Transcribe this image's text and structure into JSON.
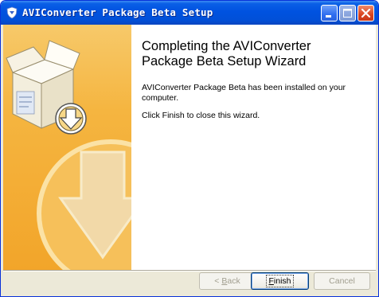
{
  "window": {
    "title": "AVIConverter Package Beta Setup",
    "title_color": "#ffffff"
  },
  "controls": {
    "minimize_icon": "minimize-icon",
    "maximize_icon": "maximize-icon",
    "close_icon": "close-icon"
  },
  "wizard": {
    "heading": "Completing the AVIConverter Package Beta Setup Wizard",
    "message": "AVIConverter Package Beta has been installed on your computer.",
    "instruction": "Click Finish to close this wizard."
  },
  "buttons": {
    "back": {
      "prefix": "< ",
      "accel": "B",
      "rest": "ack",
      "enabled": false
    },
    "finish": {
      "accel": "F",
      "rest": "inish",
      "enabled": true,
      "default": true
    },
    "cancel": {
      "label": "Cancel",
      "enabled": false
    }
  },
  "colors": {
    "side_panel": "#f5b540",
    "titlebar": "#0052e0",
    "button_face": "#ece9d8"
  }
}
